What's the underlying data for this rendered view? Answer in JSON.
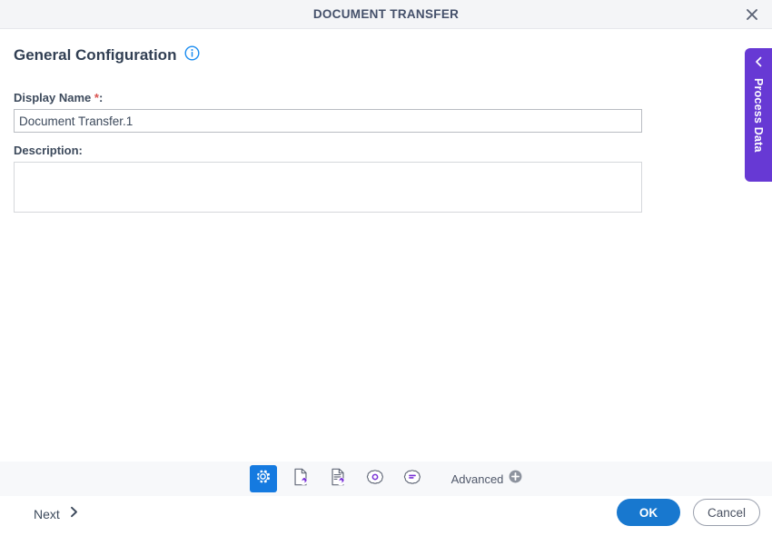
{
  "window": {
    "title": "DOCUMENT TRANSFER",
    "close_icon": "close-icon"
  },
  "section": {
    "title": "General Configuration",
    "info_icon": "info-icon"
  },
  "form": {
    "display_name": {
      "label": "Display Name",
      "required_marker": "*",
      "colon": ":",
      "value": "Document Transfer.1",
      "placeholder": ""
    },
    "description": {
      "label": "Description:",
      "value": "",
      "placeholder": ""
    }
  },
  "side_tab": {
    "label": "Process Data",
    "chevron_icon": "chevron-left-icon",
    "color": "#6739d4"
  },
  "toolbar": {
    "items": [
      {
        "name": "general-configuration-tool",
        "icon": "gear-icon",
        "active": true
      },
      {
        "name": "document-configuration-tool",
        "icon": "document-gear-icon",
        "active": false
      },
      {
        "name": "document-lines-configuration-tool",
        "icon": "document-lines-gear-icon",
        "active": false
      },
      {
        "name": "settings-tool",
        "icon": "gear-circle-icon",
        "active": false
      },
      {
        "name": "options-tool",
        "icon": "gear-lines-icon",
        "active": false
      }
    ],
    "advanced": {
      "label": "Advanced",
      "icon": "plus-circle-icon"
    }
  },
  "footer": {
    "next": {
      "label": "Next",
      "icon": "chevron-right-icon"
    },
    "ok": "OK",
    "cancel": "Cancel"
  },
  "colors": {
    "accent_blue": "#1878cf",
    "purple": "#6739d4",
    "required_red": "#d9534f",
    "title_text": "#44506a"
  }
}
